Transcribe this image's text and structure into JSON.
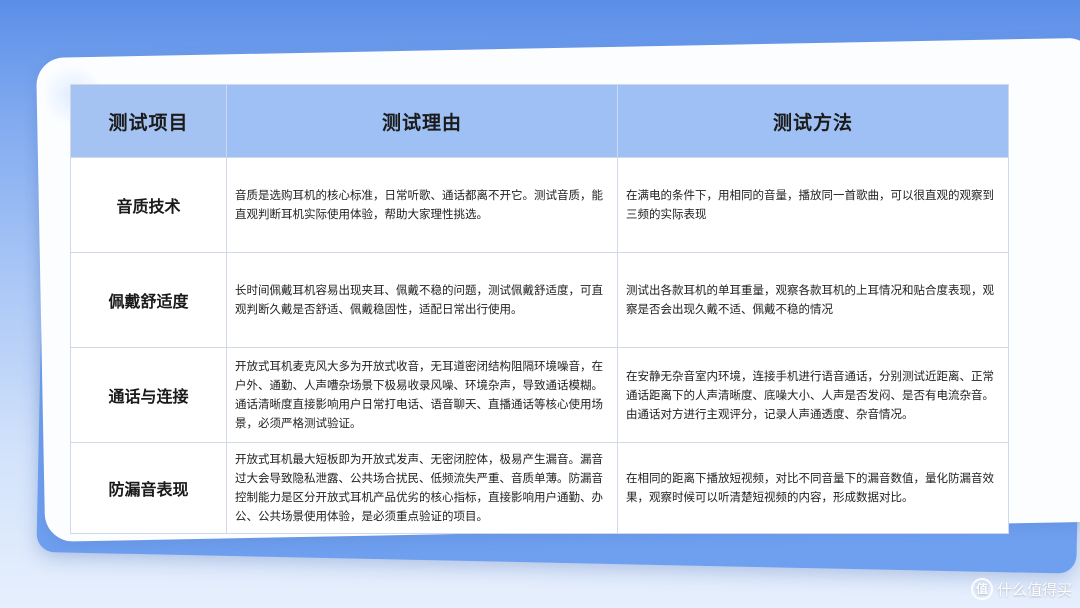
{
  "table": {
    "headers": [
      "测试项目",
      "测试理由",
      "测试方法"
    ],
    "rows": [
      {
        "item": "音质技术",
        "reason": "音质是选购耳机的核心标准，日常听歌、通话都离不开它。测试音质，能直观判断耳机实际使用体验，帮助大家理性挑选。",
        "method": "在满电的条件下，用相同的音量，播放同一首歌曲，可以很直观的观察到三频的实际表现"
      },
      {
        "item": "佩戴舒适度",
        "reason": "长时间佩戴耳机容易出现夹耳、佩戴不稳的问题，测试佩戴舒适度，可直观判断久戴是否舒适、佩戴稳固性，适配日常出行使用。",
        "method": "测试出各款耳机的单耳重量，观察各款耳机的上耳情况和贴合度表现，观察是否会出现久戴不适、佩戴不稳的情况"
      },
      {
        "item": "通话与连接",
        "reason": "开放式耳机麦克风大多为开放式收音，无耳道密闭结构阻隔环境噪音，在户外、通勤、人声嘈杂场景下极易收录风噪、环境杂声，导致通话模糊。通话清晰度直接影响用户日常打电话、语音聊天、直播通话等核心使用场景，必须严格测试验证。",
        "method": "在安静无杂音室内环境，连接手机进行语音通话，分别测试近距离、正常通话距离下的人声清晰度、底噪大小、人声是否发闷、是否有电流杂音。由通话对方进行主观评分，记录人声通透度、杂音情况。"
      },
      {
        "item": "防漏音表现",
        "reason": "开放式耳机最大短板即为开放式发声、无密闭腔体，极易产生漏音。漏音过大会导致隐私泄露、公共场合扰民、低频流失严重、音质单薄。防漏音控制能力是区分开放式耳机产品优劣的核心指标，直接影响用户通勤、办公、公共场景使用体验，是必须重点验证的项目。",
        "method": "在相同的距离下播放短视频，对比不同音量下的漏音数值，量化防漏音效果，观察时候可以听清楚短视频的内容，形成数据对比。"
      }
    ]
  },
  "watermark": {
    "icon_glyph": "值",
    "text": "什么值得买",
    "icon": "smzdm-logo-icon"
  },
  "colors": {
    "background_top": "#5a8ee8",
    "header_fill": "#9ec0f4",
    "back_sheet": "#6f9fef"
  }
}
